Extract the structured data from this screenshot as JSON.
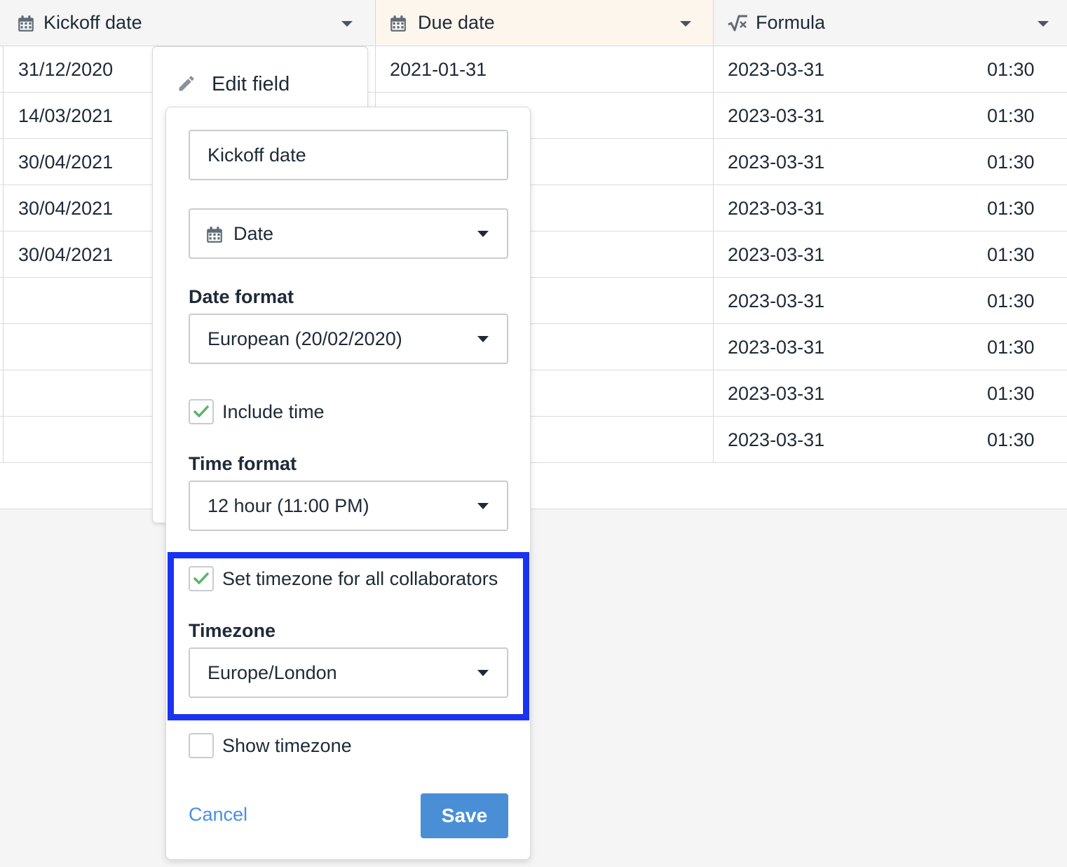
{
  "grid": {
    "columns": [
      {
        "label": "Kickoff date",
        "icon": "calendar-icon"
      },
      {
        "label": "Due date",
        "icon": "calendar-icon"
      },
      {
        "label": "Formula",
        "icon": "formula-icon"
      }
    ],
    "rows": [
      {
        "kickoff": "31/12/2020",
        "due": "2021-01-31",
        "formula_date": "2023-03-31",
        "formula_time": "01:30"
      },
      {
        "kickoff": "14/03/2021",
        "due": "",
        "formula_date": "2023-03-31",
        "formula_time": "01:30"
      },
      {
        "kickoff": "30/04/2021",
        "due": "",
        "formula_date": "2023-03-31",
        "formula_time": "01:30"
      },
      {
        "kickoff": "30/04/2021",
        "due": "",
        "formula_date": "2023-03-31",
        "formula_time": "01:30"
      },
      {
        "kickoff": "30/04/2021",
        "due": "",
        "formula_date": "2023-03-31",
        "formula_time": "01:30"
      },
      {
        "kickoff": "",
        "due": "",
        "formula_date": "2023-03-31",
        "formula_time": "01:30"
      },
      {
        "kickoff": "",
        "due": "",
        "formula_date": "2023-03-31",
        "formula_time": "01:30"
      },
      {
        "kickoff": "",
        "due": "",
        "formula_date": "2023-03-31",
        "formula_time": "01:30"
      },
      {
        "kickoff": "",
        "due": "",
        "formula_date": "2023-03-31",
        "formula_time": "01:30"
      }
    ]
  },
  "context_menu": {
    "edit_field_label": "Edit field",
    "icon": "pencil-icon"
  },
  "edit_panel": {
    "name_value": "Kickoff date",
    "type_value": "Date",
    "type_icon": "calendar-icon",
    "date_format_label": "Date format",
    "date_format_value": "European (20/02/2020)",
    "include_time_label": "Include time",
    "include_time_checked": true,
    "time_format_label": "Time format",
    "time_format_value": "12 hour (11:00 PM)",
    "set_timezone_label": "Set timezone for all collaborators",
    "set_timezone_checked": true,
    "timezone_label": "Timezone",
    "timezone_value": "Europe/London",
    "show_timezone_label": "Show timezone",
    "show_timezone_checked": false,
    "cancel_label": "Cancel",
    "save_label": "Save"
  },
  "colors": {
    "highlight": "#1a33f0",
    "primary_button": "#4a8fd6",
    "link": "#4a90e2",
    "check": "#5bb36a",
    "due_header_bg": "#fdf6ec"
  }
}
